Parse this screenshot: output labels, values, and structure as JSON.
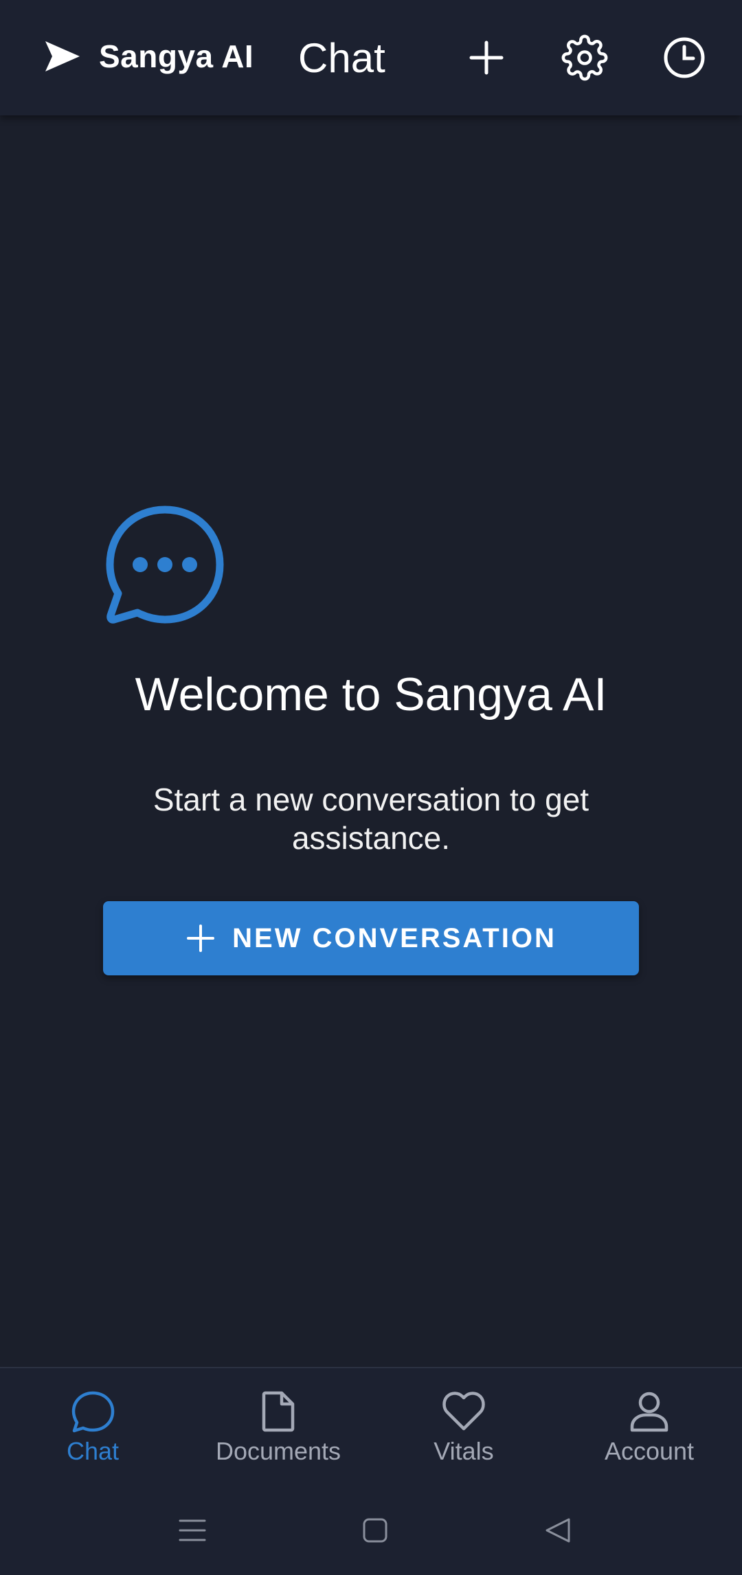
{
  "header": {
    "brand_name": "Sangya AI",
    "title": "Chat",
    "icons": [
      "send-logo-icon",
      "plus-icon",
      "gear-icon",
      "clock-icon"
    ]
  },
  "main": {
    "welcome_title": "Welcome to Sangya AI",
    "welcome_subtitle": "Start a new conversation to get assistance.",
    "new_conversation_label": "NEW CONVERSATION",
    "icon": "chat-bubble-dots-icon"
  },
  "bottom_nav": {
    "items": [
      {
        "label": "Chat",
        "icon": "chat-bubble-icon",
        "active": true
      },
      {
        "label": "Documents",
        "icon": "document-icon",
        "active": false
      },
      {
        "label": "Vitals",
        "icon": "heart-icon",
        "active": false
      },
      {
        "label": "Account",
        "icon": "user-icon",
        "active": false
      }
    ]
  },
  "system_nav": {
    "icons": [
      "menu-icon",
      "home-square-icon",
      "back-triangle-icon"
    ]
  },
  "colors": {
    "background": "#1b1f2b",
    "bar": "#1c2130",
    "accent": "#2e7fd0",
    "muted_text": "#a4a9b6"
  }
}
